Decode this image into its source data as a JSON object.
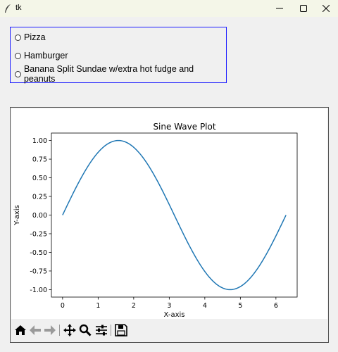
{
  "window": {
    "title": "tk",
    "controls": [
      "minimize",
      "maximize",
      "close"
    ]
  },
  "radio_group": {
    "options": [
      {
        "label": "Pizza",
        "selected": false
      },
      {
        "label": "Hamburger",
        "selected": false
      },
      {
        "label": "Banana Split Sundae w/extra hot fudge and peanuts",
        "selected": false
      }
    ]
  },
  "toolbar": {
    "tools": [
      "home-icon",
      "back-icon",
      "forward-icon",
      "pan-icon",
      "zoom-icon",
      "configure-subplots-icon",
      "save-icon"
    ]
  },
  "colors": {
    "line": "#1f77b4",
    "frame_border": "#1a1aff"
  },
  "chart_data": {
    "type": "line",
    "title": "Sine Wave Plot",
    "xlabel": "X-axis",
    "ylabel": "Y-axis",
    "xlim": [
      -0.314,
      6.597
    ],
    "ylim": [
      -1.1,
      1.1
    ],
    "xticks": [
      0,
      1,
      2,
      3,
      4,
      5,
      6
    ],
    "yticks": [
      -1.0,
      -0.75,
      -0.5,
      -0.25,
      0.0,
      0.25,
      0.5,
      0.75,
      1.0
    ],
    "ytick_labels": [
      "-1.00",
      "-0.75",
      "-0.50",
      "-0.25",
      "0.00",
      "0.25",
      "0.50",
      "0.75",
      "1.00"
    ],
    "grid": false,
    "series": [
      {
        "function": "sin",
        "x": [
          0.0,
          0.314,
          0.628,
          0.942,
          1.257,
          1.571,
          1.885,
          2.199,
          2.513,
          2.827,
          3.142,
          3.456,
          3.77,
          4.084,
          4.398,
          4.712,
          5.027,
          5.341,
          5.655,
          5.969,
          6.283
        ],
        "y": [
          0.0,
          0.309,
          0.588,
          0.809,
          0.951,
          1.0,
          0.951,
          0.809,
          0.588,
          0.309,
          0.0,
          -0.309,
          -0.588,
          -0.809,
          -0.951,
          -1.0,
          -0.951,
          -0.809,
          -0.588,
          -0.309,
          0.0
        ]
      }
    ]
  }
}
